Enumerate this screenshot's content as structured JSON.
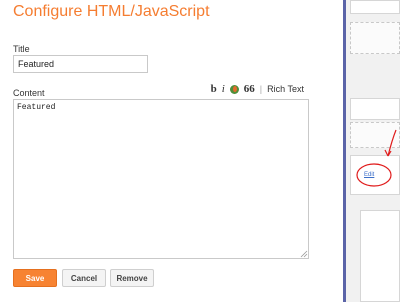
{
  "dialog": {
    "title": "Configure HTML/JavaScript",
    "title_label": "Title",
    "title_value": "Featured",
    "content_label": "Content",
    "content_value": "Featured",
    "toolbar": {
      "bold": "b",
      "italic": "i",
      "quote": "66",
      "separator": "|",
      "rich_text": "Rich Text",
      "icons": [
        "bold-icon",
        "italic-icon",
        "link-icon",
        "quote-icon"
      ]
    },
    "buttons": {
      "save": "Save",
      "cancel": "Cancel",
      "remove": "Remove"
    }
  },
  "background_layout": {
    "edit_link": "Edit"
  },
  "colors": {
    "accent": "#f57d31",
    "save_button": "#f78332",
    "divider": "#5b64a8",
    "annotation": "#e01b1b",
    "link": "#3b6ec9"
  }
}
